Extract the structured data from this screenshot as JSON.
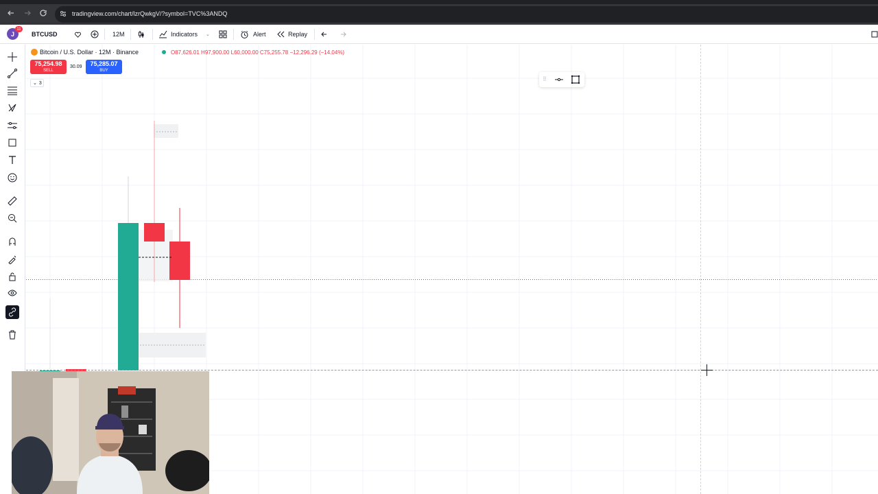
{
  "browser": {
    "url": "tradingview.com/chart/lzrQwkgV/?symbol=TVC%3ANDQ",
    "back_icon": "arrow-left-icon",
    "forward_icon": "arrow-right-icon",
    "reload_icon": "reload-icon"
  },
  "toolbar": {
    "avatar_letter": "J",
    "notification_count": "11",
    "symbol": "BTCUSD",
    "interval": "12M",
    "indicators_label": "Indicators",
    "alert_label": "Alert",
    "replay_label": "Replay"
  },
  "legend": {
    "title": "Bitcoin / U.S. Dollar · 12M · Binance",
    "ohlc": "O87,626.01 H97,900.00 L60,000.00 C75,255.78 −12,296.29 (−14.04%)",
    "sell_price": "75,254.98",
    "sell_label": "SELL",
    "spread": "30.09",
    "buy_price": "75,285.07",
    "buy_label": "BUY",
    "collapse_count": "3"
  },
  "colors": {
    "up": "#22ab94",
    "down": "#f23645",
    "accent": "#2962ff"
  },
  "left_toolbar": [
    "crosshair-icon",
    "trend-line-icon",
    "fib-icon",
    "pattern-icon",
    "forecast-icon",
    "brush-icon",
    "text-icon",
    "emoji-icon",
    "ruler-icon",
    "zoom-icon",
    "magnet-icon",
    "stay-drawing-icon",
    "lock-icon",
    "eye-icon",
    "link-icon",
    "trash-icon"
  ],
  "floating_toolbar": [
    "grip-icon",
    "horizontal-line-icon",
    "rectangle-icon"
  ]
}
